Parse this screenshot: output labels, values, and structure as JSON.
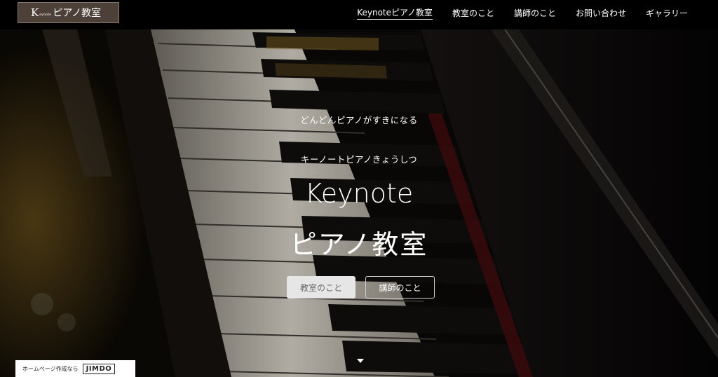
{
  "header": {
    "logo": {
      "letter": "K",
      "small": "eynote",
      "main": "ピアノ教室"
    },
    "nav": [
      {
        "label": "Keynoteピアノ教室",
        "active": true
      },
      {
        "label": "教室のこと"
      },
      {
        "label": "講師のこと"
      },
      {
        "label": "お問い合わせ"
      },
      {
        "label": "ギャラリー"
      }
    ]
  },
  "hero": {
    "subtitle1": "どんどんピアノがすきになる",
    "subtitle2": "キーノートピアノきょうしつ",
    "title_line1": "Keynote",
    "title_line2": "ピアノ教室",
    "buttons": [
      {
        "label": "教室のこと",
        "style": "filled"
      },
      {
        "label": "講師のこと",
        "style": "outline"
      }
    ],
    "scroll_icon": "chevron-down-icon"
  },
  "badge": {
    "text": "ホームページ作成なら",
    "logo": "JIMDO"
  },
  "colors": {
    "header_bg": "#000000",
    "logo_bg": "#4d4038",
    "button_filled_bg": "#e6e6e6",
    "button_filled_text": "#6a6a6a"
  }
}
